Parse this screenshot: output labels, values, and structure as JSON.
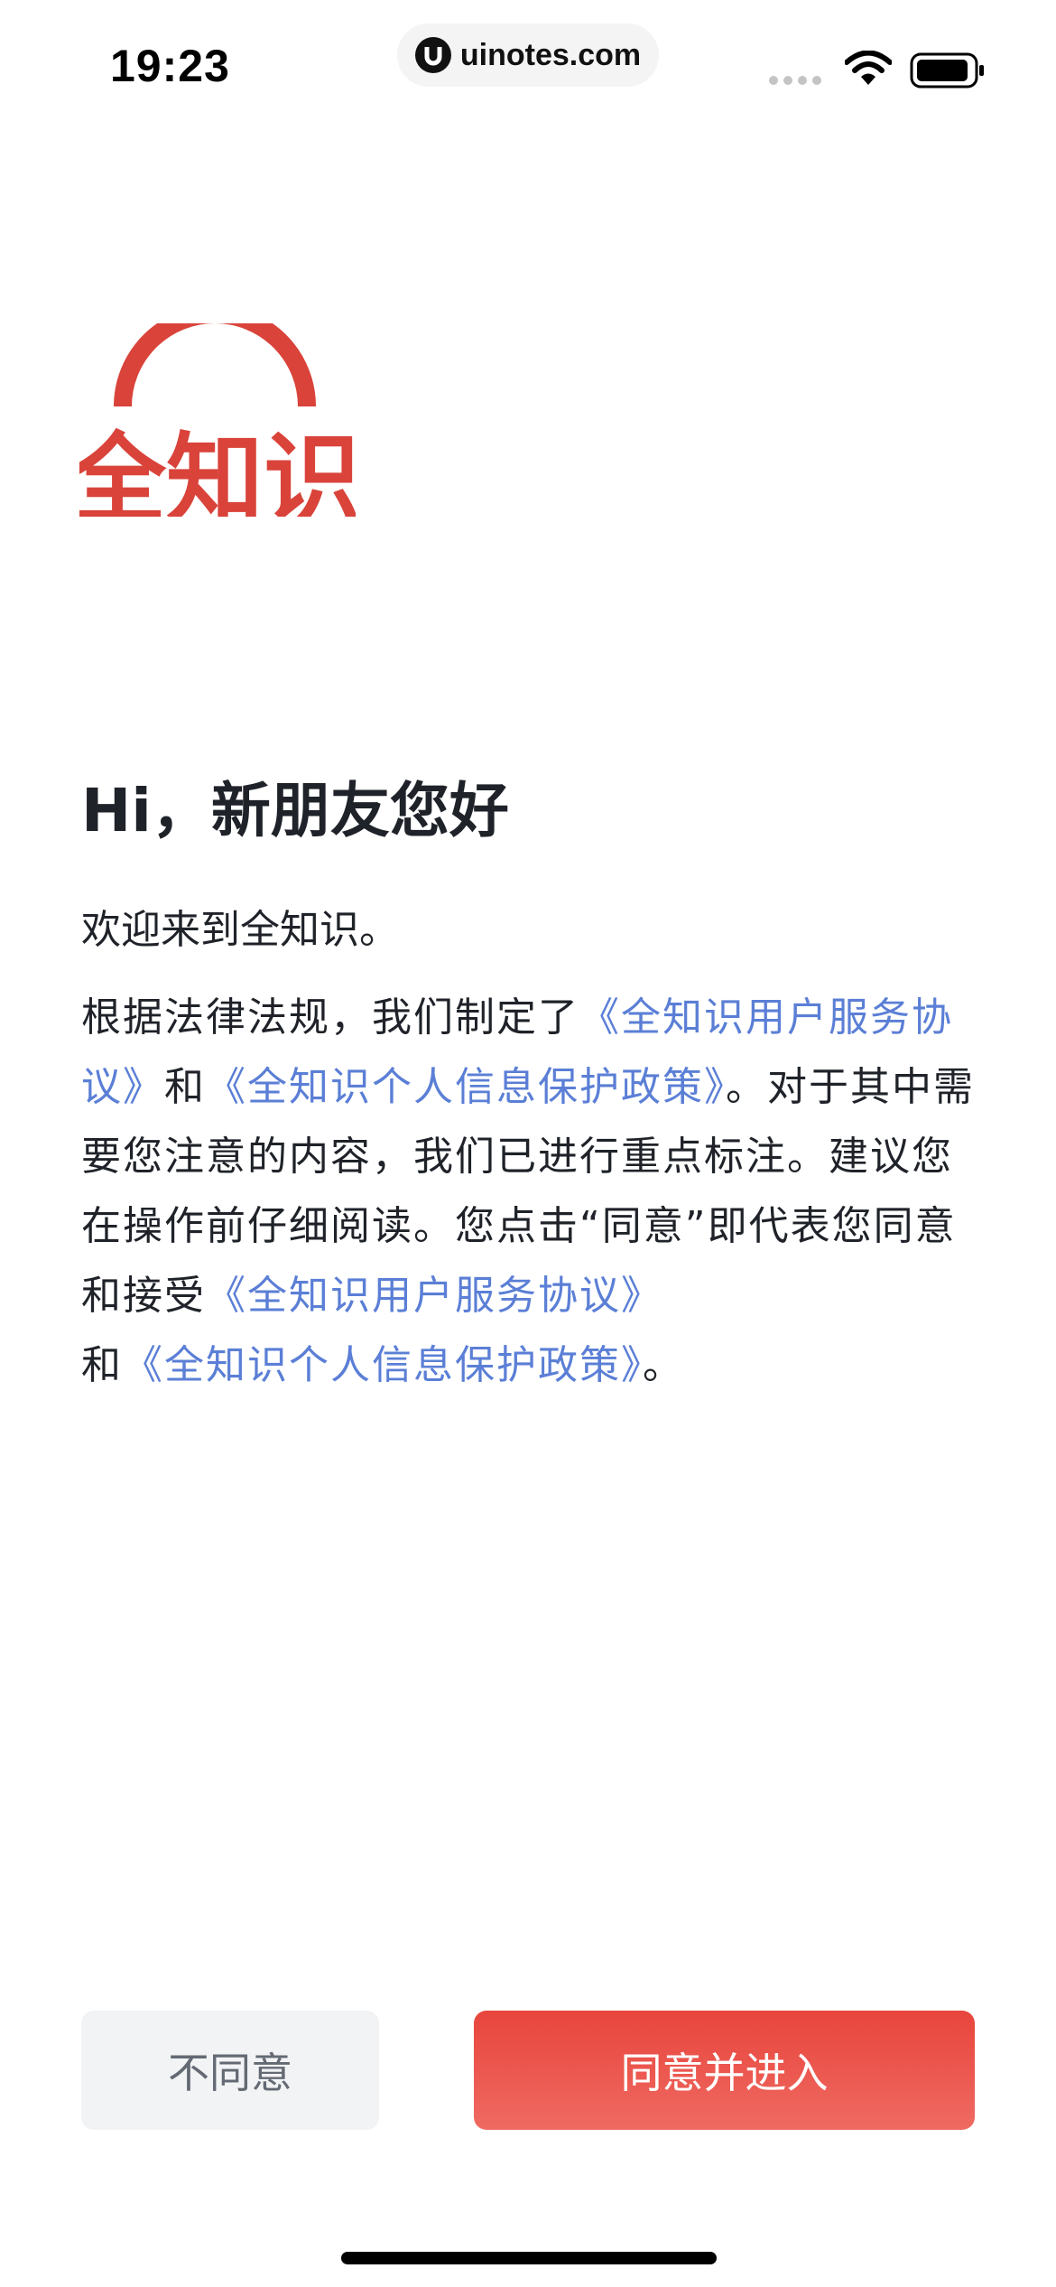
{
  "status_bar": {
    "time": "19:23",
    "url": "uinotes.com",
    "icons": [
      "signal-icon",
      "wifi-icon",
      "battery-icon"
    ]
  },
  "logo": {
    "text": "全知识",
    "color": "#d9433a"
  },
  "greeting": "Hi，新朋友您好",
  "welcome": "欢迎来到全知识。",
  "agreement": {
    "part1": "根据法律法规，我们制定了",
    "link_user_agreement": "《全知识用户服务协议》",
    "and1": "和",
    "link_privacy_policy": "《全知识个人信息保护政策》",
    "part2": "。对于其中需要您注意的内容，我们已进行重点标注。建议您在操作前仔细阅读。您点击“同意”即代表您同意和接受",
    "link_user_agreement_2": "《全知识用户服务协议》",
    "and2": "和",
    "link_privacy_policy_2": "《全知识个人信息保护政策》",
    "end": "。"
  },
  "buttons": {
    "disagree": "不同意",
    "agree": "同意并进入"
  },
  "colors": {
    "accent": "#e8453c",
    "link": "#5b7fd6",
    "secondary_button_bg": "#f2f3f5"
  }
}
